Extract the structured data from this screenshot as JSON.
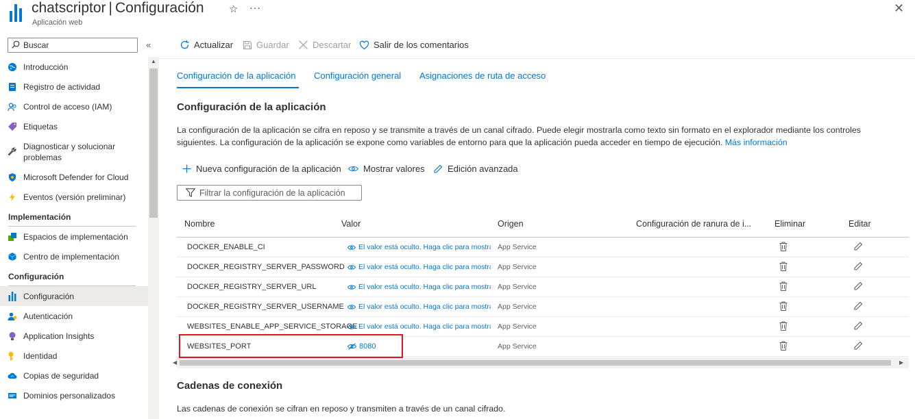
{
  "header": {
    "app_name": "chatscriptor",
    "separator": "|",
    "page_name": "Configuración",
    "subtitle": "Aplicación web",
    "star_glyph": "☆",
    "more_glyph": "···",
    "close_glyph": "✕"
  },
  "sidebar": {
    "search_placeholder": "Buscar",
    "collapse_glyph": "«",
    "items_top": [
      {
        "label": "Introducción",
        "icon": "globe-icon"
      },
      {
        "label": "Registro de actividad",
        "icon": "activity-log-icon"
      },
      {
        "label": "Control de acceso (IAM)",
        "icon": "people-icon"
      },
      {
        "label": "Etiquetas",
        "icon": "tag-icon"
      },
      {
        "label": "Diagnosticar y solucionar problemas",
        "icon": "wrench-icon"
      },
      {
        "label": "Microsoft Defender for Cloud",
        "icon": "shield-icon"
      },
      {
        "label": "Eventos (versión preliminar)",
        "icon": "lightning-icon"
      }
    ],
    "section_deploy": "Implementación",
    "items_deploy": [
      {
        "label": "Espacios de implementación",
        "icon": "slots-icon"
      },
      {
        "label": "Centro de implementación",
        "icon": "cube-icon"
      }
    ],
    "section_config": "Configuración",
    "items_config": [
      {
        "label": "Configuración",
        "icon": "config-bars-icon"
      },
      {
        "label": "Autenticación",
        "icon": "auth-user-icon"
      },
      {
        "label": "Application Insights",
        "icon": "bulb-icon"
      },
      {
        "label": "Identidad",
        "icon": "key-icon"
      },
      {
        "label": "Copias de seguridad",
        "icon": "cloud-backup-icon"
      },
      {
        "label": "Dominios personalizados",
        "icon": "domain-icon"
      }
    ]
  },
  "toolbar": {
    "refresh": "Actualizar",
    "save": "Guardar",
    "discard": "Descartar",
    "feedback": "Salir de los comentarios"
  },
  "tabs": {
    "app_settings": "Configuración de la aplicación",
    "general": "Configuración general",
    "path_mappings": "Asignaciones de ruta de acceso"
  },
  "main": {
    "section_title": "Configuración de la aplicación",
    "description": "La configuración de la aplicación se cifra en reposo y se transmite a través de un canal cifrado. Puede elegir mostrarla como texto sin formato en el explorador mediante los controles siguientes. La configuración de la aplicación se expone como variables de entorno para que la aplicación pueda acceder en tiempo de ejecución.",
    "learn_more": "Más información",
    "new_setting": "Nueva configuración de la aplicación",
    "show_values": "Mostrar valores",
    "advanced_edit": "Edición avanzada",
    "filter_placeholder": "Filtrar la configuración de la aplicación",
    "connection_title": "Cadenas de conexión",
    "connection_desc": "Las cadenas de conexión se cifran en reposo y transmiten a través de un canal cifrado."
  },
  "table": {
    "headers": {
      "name": "Nombre",
      "value": "Valor",
      "origin": "Origen",
      "slot": "Configuración de ranura de i...",
      "delete": "Eliminar",
      "edit": "Editar"
    },
    "rows": [
      {
        "name": "DOCKER_ENABLE_CI",
        "value": "El valor está oculto. Haga clic para mostrar",
        "origin": "App Service"
      },
      {
        "name": "DOCKER_REGISTRY_SERVER_PASSWORD",
        "value": "El valor está oculto. Haga clic para mostrar",
        "origin": "App Service"
      },
      {
        "name": "DOCKER_REGISTRY_SERVER_URL",
        "value": "El valor está oculto. Haga clic para mostrar",
        "origin": "App Service"
      },
      {
        "name": "DOCKER_REGISTRY_SERVER_USERNAME",
        "value": "El valor está oculto. Haga clic para mostrar",
        "origin": "App Service"
      },
      {
        "name": "WEBSITES_ENABLE_APP_SERVICE_STORAGE",
        "value": "El valor está oculto. Haga clic para mostrar",
        "origin": "App Service"
      },
      {
        "name": "WEBSITES_PORT",
        "value": "8080",
        "origin": "App Service"
      }
    ]
  },
  "colors": {
    "accent": "#0078d4",
    "highlight_box": "#e81123"
  }
}
